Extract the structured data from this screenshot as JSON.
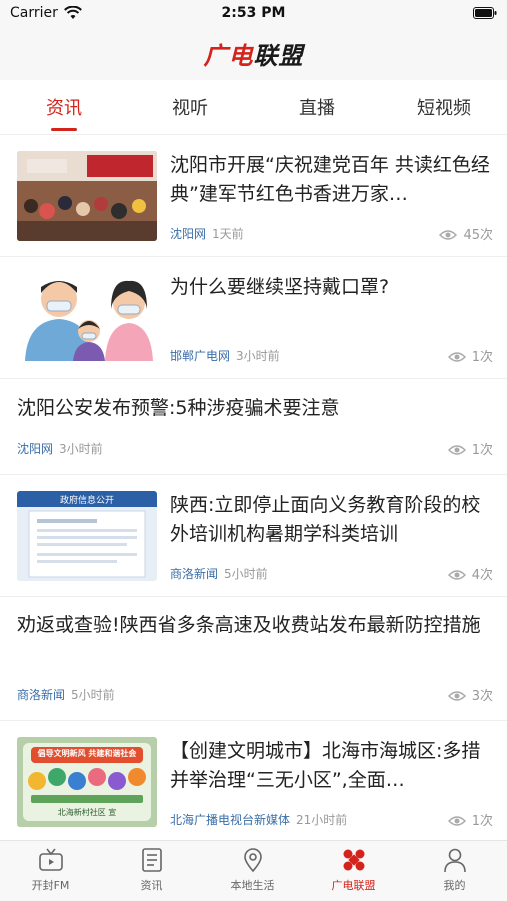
{
  "status_bar": {
    "carrier": "Carrier",
    "time": "2:53 PM"
  },
  "header": {
    "logo_part1": "广电",
    "logo_part2": "联盟"
  },
  "tabs": [
    {
      "label": "资讯",
      "active": true
    },
    {
      "label": "视听",
      "active": false
    },
    {
      "label": "直播",
      "active": false
    },
    {
      "label": "短视频",
      "active": false
    }
  ],
  "news": [
    {
      "title": "沈阳市开展“庆祝建党百年 共读红色经典”建军节红色书香进万家…",
      "source": "沈阳网",
      "time": "1天前",
      "views": "45次",
      "thumb": "event-photo"
    },
    {
      "title": "为什么要继续坚持戴口罩?",
      "source": "邯郸广电网",
      "time": "3小时前",
      "views": "1次",
      "thumb": "mask-family-illustration"
    },
    {
      "title": "沈阳公安发布预警:5种涉疫骗术要注意",
      "source": "沈阳网",
      "time": "3小时前",
      "views": "1次"
    },
    {
      "title": "陕西:立即停止面向义务教育阶段的校外培训机构暑期学科类培训",
      "source": "商洛新闻",
      "time": "5小时前",
      "views": "4次",
      "thumb": "gov-info-screenshot",
      "thumb_heading": "政府信息公开"
    },
    {
      "title": "劝返或查验!陕西省多条高速及收费站发布最新防控措施",
      "source": "商洛新闻",
      "time": "5小时前",
      "views": "3次"
    },
    {
      "title": "【创建文明城市】北海市海城区:多措并举治理“三无小区”,全面…",
      "source": "北海广播电视台新媒体",
      "time": "21小时前",
      "views": "1次",
      "thumb": "civility-poster",
      "thumb_heading": "倡导文明新风 共建和谐社会",
      "thumb_caption": "北海新村社区 宣"
    }
  ],
  "bottom_nav": [
    {
      "label": "开封FM",
      "icon": "tv-icon",
      "active": false
    },
    {
      "label": "资讯",
      "icon": "news-list-icon",
      "active": false
    },
    {
      "label": "本地生活",
      "icon": "location-pin-icon",
      "active": false
    },
    {
      "label": "广电联盟",
      "icon": "alliance-icon",
      "active": true
    },
    {
      "label": "我的",
      "icon": "person-icon",
      "active": false
    }
  ],
  "colors": {
    "accent": "#d4231b",
    "source_blue": "#3a6ea8",
    "meta_gray": "#999999"
  }
}
